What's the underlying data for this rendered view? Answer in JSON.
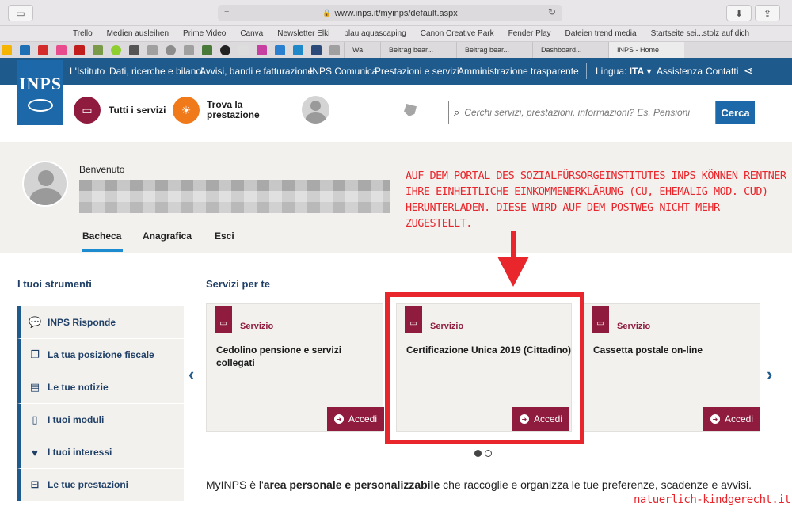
{
  "browser": {
    "url": "www.inps.it/myinps/default.aspx",
    "favorites": [
      "Trello",
      "Medien ausleihen",
      "Prime Video",
      "Canva",
      "Newsletter Elki",
      "blau aquascaping",
      "Canon Creative Park",
      "Fender Play",
      "Dateien trend media",
      "Startseite sei...stolz auf dich"
    ],
    "tabs": [
      "Wa",
      "Beitrag bear...",
      "Beitrag bear...",
      "Dashboard...",
      "INPS - Home"
    ]
  },
  "nav": {
    "items": [
      "L'Istituto",
      "Dati, ricerche e bilanci",
      "Avvisi, bandi e fatturazione",
      "INPS Comunica",
      "Prestazioni e servizi",
      "Amministrazione trasparente"
    ],
    "lingua_label": "Lingua:",
    "lingua_value": "ITA",
    "assistenza": "Assistenza",
    "contatti": "Contatti"
  },
  "logo": {
    "text": "INPS"
  },
  "header": {
    "tutti_servizi": "Tutti i servizi",
    "trova_line1": "Trova la",
    "trova_line2": "prestazione",
    "search_placeholder": "Cerchi servizi, prestazioni, informazioni? Es. Pensioni",
    "search_button": "Cerca"
  },
  "user": {
    "greeting": "Benvenuto",
    "tabs": [
      "Bacheca",
      "Anagrafica",
      "Esci"
    ]
  },
  "annotation": {
    "lines": [
      "AUF DEM PORTAL DES SOZIALFÜRSORGEINSTITUTES INPS KÖNNEN RENTNER",
      "IHRE EINHEITLICHE EINKOMMENERKLÄRUNG (CU, EHEMALIG MOD. CUD)",
      "HERUNTERLADEN. DIESE WIRD AUF DEM POSTWEG NICHT MEHR ZUGESTELLT."
    ]
  },
  "tools": {
    "title": "I tuoi strumenti",
    "items": [
      "INPS Risponde",
      "La tua posizione fiscale",
      "Le tue notizie",
      "I tuoi moduli",
      "I tuoi interessi",
      "Le tue prestazioni"
    ]
  },
  "services": {
    "title": "Servizi per te",
    "cards": [
      {
        "kind": "Servizio",
        "title": "Cedolino pensione e servizi collegati",
        "action": "Accedi"
      },
      {
        "kind": "Servizio",
        "title": "Certificazione Unica 2019 (Cittadino)",
        "action": "Accedi"
      },
      {
        "kind": "Servizio",
        "title": "Cassetta postale on-line",
        "action": "Accedi"
      }
    ]
  },
  "intro": {
    "part1": "MyINPS è l'",
    "bold": "area personale e personalizzabile",
    "part2": " che raccoglie e organizza le tue preferenze, scadenze e avvisi."
  },
  "watermark": "natuerlich-kindgerecht.it"
}
